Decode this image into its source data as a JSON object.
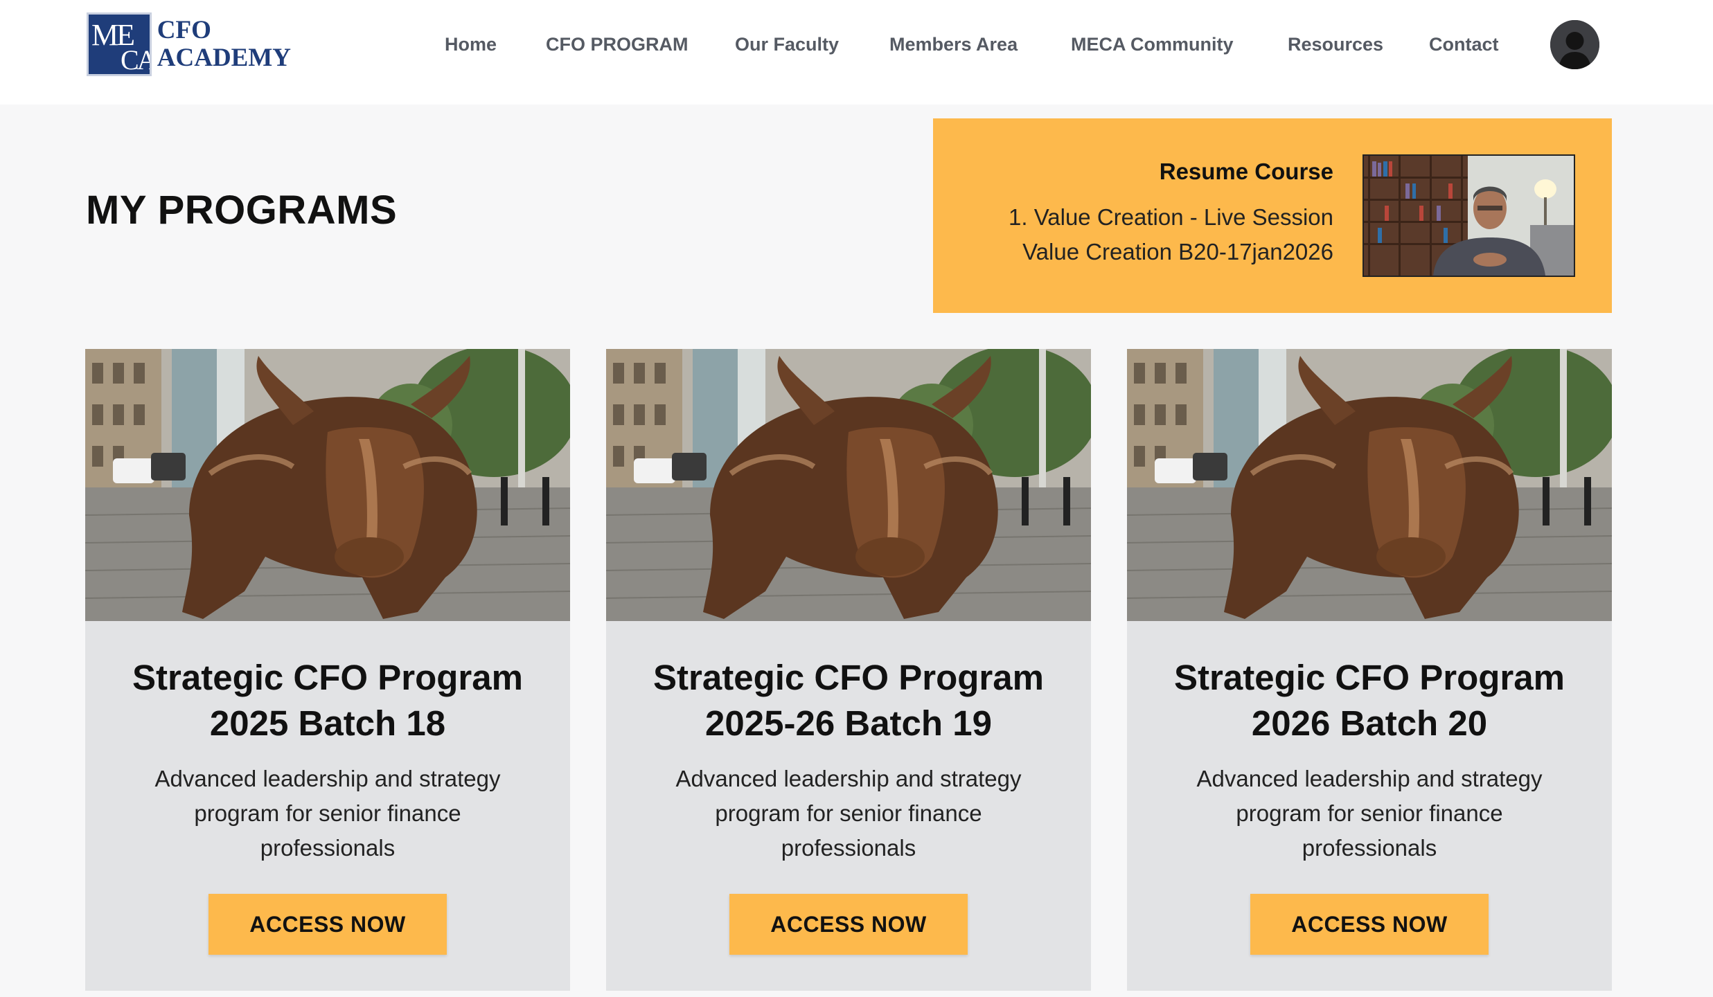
{
  "header": {
    "logo": {
      "line1": "CFO",
      "line2": "ACADEMY",
      "mark": "MECA"
    },
    "nav": [
      "Home",
      "CFO PROGRAM",
      "Our Faculty",
      "Members Area",
      "MECA Community",
      "Resources",
      "Contact"
    ],
    "avatar_icon": "user-avatar-icon"
  },
  "page": {
    "title": "MY PROGRAMS"
  },
  "resume": {
    "label": "Resume Course",
    "lesson": "1. Value Creation - Live Session",
    "session": "Value Creation B20-17jan2026"
  },
  "programs": [
    {
      "title_line1": "Strategic CFO Program",
      "title_line2": "2025 Batch 18",
      "description": "Advanced leadership and strategy program for senior finance professionals",
      "button": "ACCESS NOW"
    },
    {
      "title_line1": "Strategic CFO Program",
      "title_line2": "2025-26 Batch 19",
      "description": "Advanced leadership and strategy program for senior finance professionals",
      "button": "ACCESS NOW"
    },
    {
      "title_line1": "Strategic CFO Program",
      "title_line2": "2026 Batch 20",
      "description": "Advanced leadership and strategy program for senior finance professionals",
      "button": "ACCESS NOW"
    }
  ],
  "colors": {
    "accent": "#fdb94c",
    "brand_navy": "#1f3d7a",
    "card_bg": "#e2e3e5",
    "nav_text": "#555a63"
  }
}
